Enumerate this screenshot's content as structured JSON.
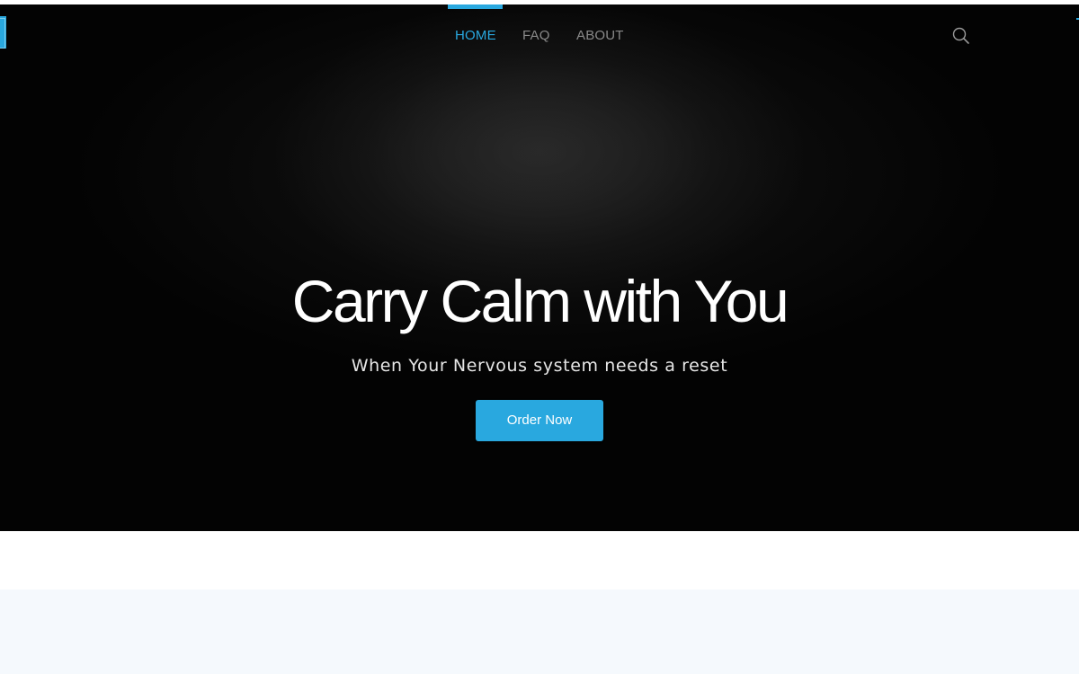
{
  "nav": {
    "items": [
      {
        "label": "HOME",
        "active": true
      },
      {
        "label": "FAQ",
        "active": false
      },
      {
        "label": "ABOUT",
        "active": false
      }
    ]
  },
  "header": {
    "search_icon": "search-icon"
  },
  "hero": {
    "headline": "Carry Calm with You",
    "subheadline": "When Your Nervous system needs a reset",
    "cta_label": "Order Now"
  },
  "colors": {
    "accent": "#29a8df",
    "hero_bg": "#000000",
    "nav_text": "#8a8a8a",
    "section_bg": "#f5f9fd"
  }
}
